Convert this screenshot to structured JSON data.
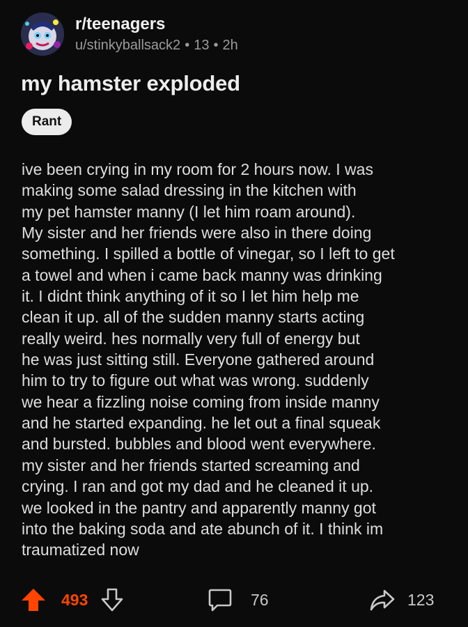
{
  "post": {
    "subreddit": "r/teenagers",
    "author": "u/stinkyballsack2",
    "author_flair": "13",
    "age": "2h",
    "separator": "•",
    "title": "my hamster exploded",
    "flair": "Rant",
    "body": "ive been crying in my room for 2 hours now. I was\nmaking some salad dressing in the kitchen with\nmy pet hamster manny (I let him roam around).\nMy sister and her friends were also in there doing\nsomething. I spilled a bottle of vinegar, so I left to get\na towel and when i came back manny was drinking\nit. I didnt think anything of it so I let him help me\nclean it up. all of the sudden manny starts acting\nreally weird. hes normally very full of energy but\nhe was just sitting still. Everyone gathered around\nhim to try to figure out what was wrong. suddenly\nwe hear a fizzling noise coming from inside manny\nand he started expanding. he let out a final squeak\nand bursted. bubbles and blood went everywhere.\nmy sister and her friends started screaming and\ncrying. I ran and got my dad and he cleaned it up.\nwe looked in the pantry and apparently manny got\ninto the baking soda and ate abunch of it. I think im\ntraumatized now"
  },
  "actions": {
    "score": "493",
    "comments": "76",
    "shares": "123"
  },
  "icons": {
    "upvote": "upvote-arrow-icon",
    "downvote": "downvote-arrow-icon",
    "comment": "comment-bubble-icon",
    "share": "share-arrow-icon"
  },
  "colors": {
    "background": "#0b0b0b",
    "upvote_active": "#ff4500",
    "flair_bg": "#ececec"
  }
}
